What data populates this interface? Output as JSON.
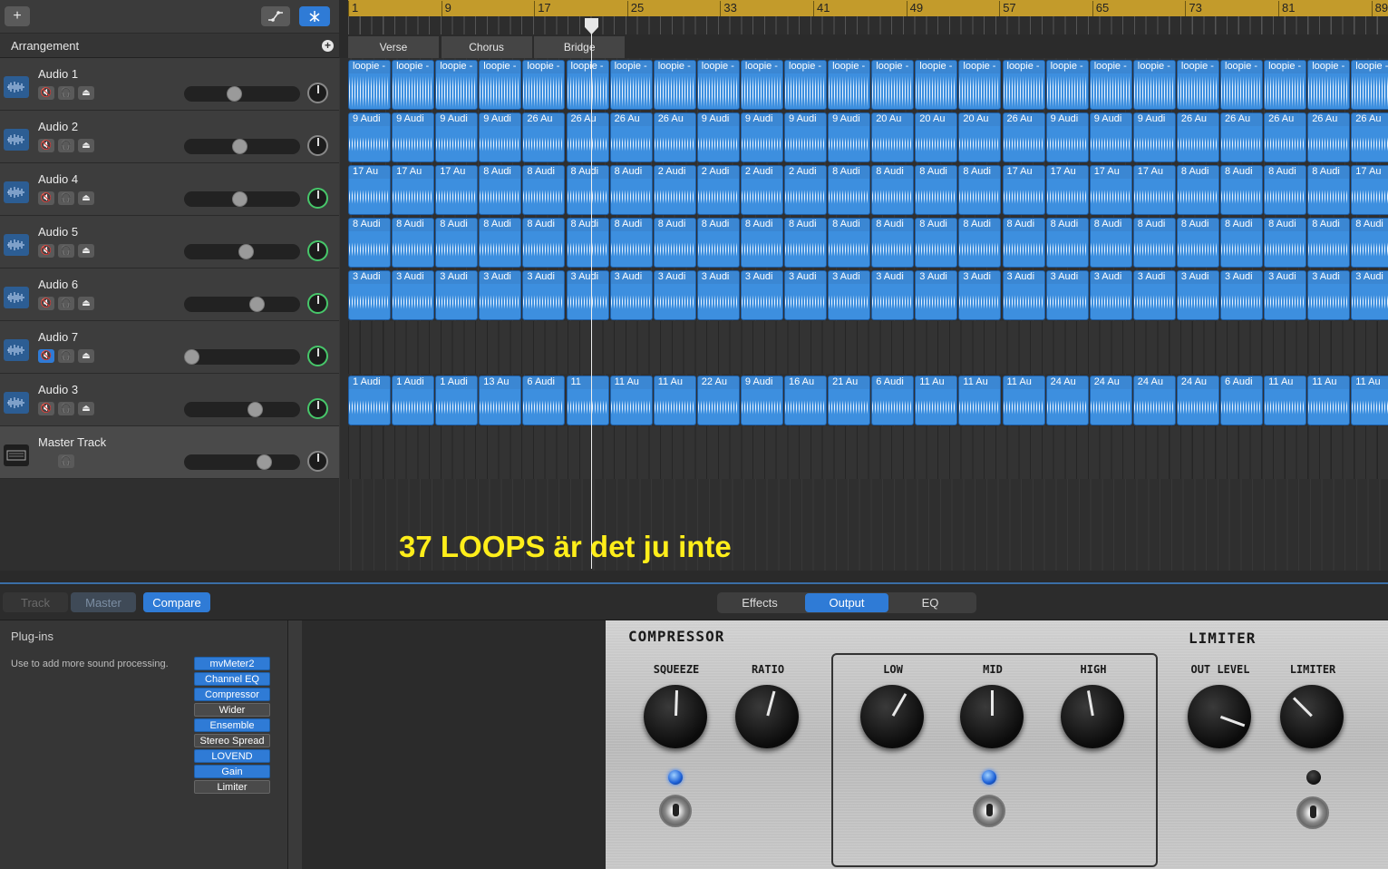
{
  "toolbar": {
    "add_icon": "+",
    "automation_icon": "automation-icon",
    "snap_icon": "snap-icon"
  },
  "arrangement": {
    "label": "Arrangement",
    "add_icon": "+"
  },
  "ruler": {
    "bars": [
      "1",
      "9",
      "17",
      "25",
      "33",
      "41",
      "49",
      "57",
      "65",
      "73",
      "81",
      "89"
    ]
  },
  "sections": [
    {
      "label": "Verse"
    },
    {
      "label": "Chorus"
    },
    {
      "label": "Bridge"
    }
  ],
  "tracks": [
    {
      "name": "Audio 1",
      "volume": 0.42,
      "pan_green": false,
      "mute": false
    },
    {
      "name": "Audio 2",
      "volume": 0.48,
      "pan_green": false,
      "mute": false
    },
    {
      "name": "Audio 4",
      "volume": 0.48,
      "pan_green": true,
      "mute": false
    },
    {
      "name": "Audio 5",
      "volume": 0.54,
      "pan_green": true,
      "mute": false
    },
    {
      "name": "Audio 6",
      "volume": 0.65,
      "pan_green": true,
      "mute": false
    },
    {
      "name": "Audio 7",
      "volume": 0.0,
      "pan_green": true,
      "mute": true
    },
    {
      "name": "Audio 3",
      "volume": 0.63,
      "pan_green": true,
      "mute": false
    },
    {
      "name": "Master Track",
      "volume": 0.72,
      "pan_green": false,
      "master": true
    }
  ],
  "track_buttons": {
    "mute": "🔇",
    "headphones": "🎧",
    "input": "⏏"
  },
  "lanes": [
    {
      "labels": [
        "loopie -",
        "loopie -",
        "loopie -",
        "loopie -",
        "loopie -",
        "loopie -",
        "loopie -",
        "loopie -",
        "loopie -",
        "loopie -",
        "loopie -",
        "loopie -",
        "loopie -",
        "loopie -",
        "loopie -",
        "loopie -",
        "loopie -",
        "loopie -",
        "loopie -",
        "loopie -",
        "loopie -",
        "loopie -",
        "loopie -",
        "loopie -"
      ],
      "loops": true
    },
    {
      "labels": [
        "9 Audi",
        "9 Audi",
        "9 Audi",
        "9 Audi",
        "26 Au",
        "26 Au",
        "26 Au",
        "26 Au",
        "9 Audi",
        "9 Audi",
        "9 Audi",
        "9 Audi",
        "20 Au",
        "20 Au",
        "20 Au",
        "26 Au",
        "9 Audi",
        "9 Audi",
        "9 Audi",
        "26 Au",
        "26 Au",
        "26 Au",
        "26 Au",
        "26 Au"
      ]
    },
    {
      "labels": [
        "17 Au",
        "17 Au",
        "17 Au",
        "8 Audi",
        "8 Audi",
        "8 Audi",
        "8 Audi",
        "2 Audi",
        "2 Audi",
        "2 Audi",
        "2 Audi",
        "8 Audi",
        "8 Audi",
        "8 Audi",
        "8 Audi",
        "17 Au",
        "17 Au",
        "17 Au",
        "17 Au",
        "8 Audi",
        "8 Audi",
        "8 Audi",
        "8 Audi",
        "17 Au"
      ]
    },
    {
      "labels": [
        "8 Audi",
        "8 Audi",
        "8 Audi",
        "8 Audi",
        "8 Audi",
        "8 Audi",
        "8 Audi",
        "8 Audi",
        "8 Audi",
        "8 Audi",
        "8 Audi",
        "8 Audi",
        "8 Audi",
        "8 Audi",
        "8 Audi",
        "8 Audi",
        "8 Audi",
        "8 Audi",
        "8 Audi",
        "8 Audi",
        "8 Audi",
        "8 Audi",
        "8 Audi",
        "8 Audi"
      ]
    },
    {
      "labels": [
        "3 Audi",
        "3 Audi",
        "3 Audi",
        "3 Audi",
        "3 Audi",
        "3 Audi",
        "3 Audi",
        "3 Audi",
        "3 Audi",
        "3 Audi",
        "3 Audi",
        "3 Audi",
        "3 Audi",
        "3 Audi",
        "3 Audi",
        "3 Audi",
        "3 Audi",
        "3 Audi",
        "3 Audi",
        "3 Audi",
        "3 Audi",
        "3 Audi",
        "3 Audi",
        "3 Audi"
      ]
    },
    {
      "labels": []
    },
    {
      "labels": [
        "1 Audi",
        "1 Audi",
        "1 Audi",
        "13 Au",
        "6 Audi",
        "11",
        "11 Au",
        "11 Au",
        "22 Au",
        "9 Audi",
        "16 Au",
        "21 Au",
        "6 Audi",
        "11 Au",
        "11 Au",
        "11 Au",
        "24 Au",
        "24 Au",
        "24 Au",
        "24 Au",
        "6 Audi",
        "11 Au",
        "11 Au",
        "11 Au"
      ]
    },
    {
      "labels": []
    }
  ],
  "overlay_text": "37 LOOPS är det ju inte",
  "smart_controls": {
    "tabs": {
      "track": "Track",
      "master": "Master",
      "compare": "Compare"
    },
    "segments": {
      "effects": "Effects",
      "output": "Output",
      "eq": "EQ"
    },
    "plugins_title": "Plug-ins",
    "plugins_help": "Use to add more sound processing.",
    "plugins": [
      {
        "name": "mvMeter2",
        "on": true
      },
      {
        "name": "Channel EQ",
        "on": true
      },
      {
        "name": "Compressor",
        "on": true
      },
      {
        "name": "Wider",
        "on": false
      },
      {
        "name": "Ensemble",
        "on": true
      },
      {
        "name": "Stereo Spread",
        "on": false
      },
      {
        "name": "LOVEND",
        "on": true
      },
      {
        "name": "Gain",
        "on": true
      },
      {
        "name": "Limiter",
        "on": false
      }
    ]
  },
  "amp": {
    "compressor_title": "COMPRESSOR",
    "limiter_title": "LIMITER",
    "knobs": {
      "squeeze": "SQUEEZE",
      "ratio": "RATIO",
      "low": "LOW",
      "mid": "MID",
      "high": "HIGH",
      "out_level": "OUT LEVEL",
      "limiter": "LIMITER"
    }
  }
}
